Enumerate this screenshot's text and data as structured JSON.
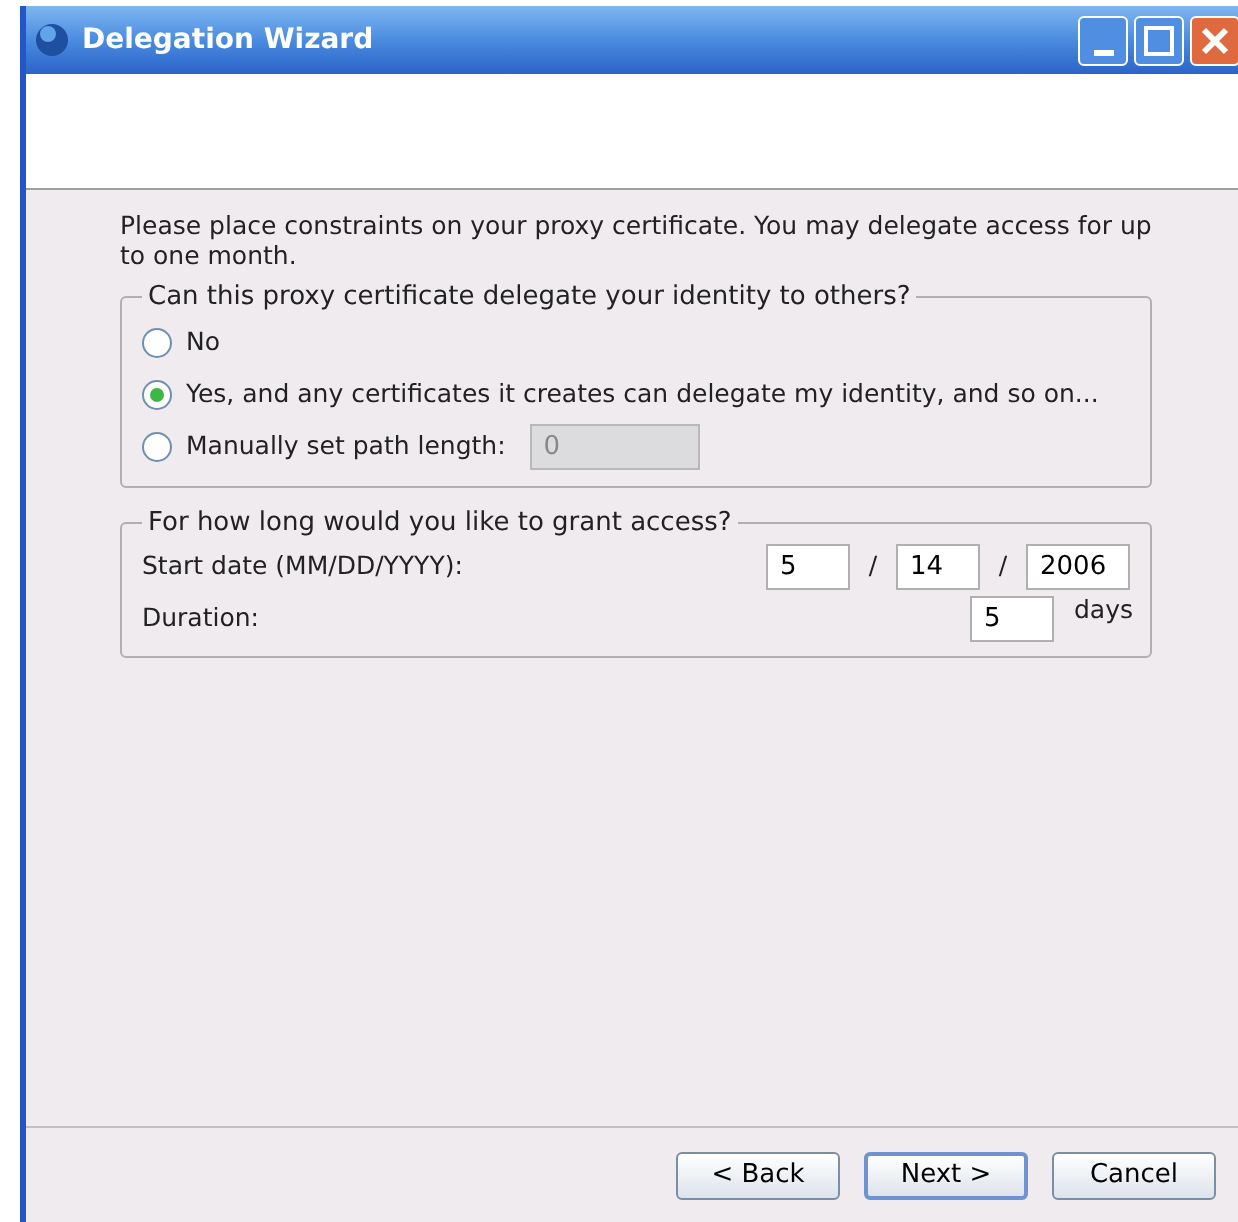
{
  "window": {
    "title": "Delegation Wizard"
  },
  "intro": "Please place constraints on your proxy certificate. You may delegate access for up to one month.",
  "delegation_group": {
    "title": "Can this proxy certificate delegate your identity to others?",
    "options": [
      {
        "label": "No",
        "selected": false
      },
      {
        "label": "Yes, and any certificates it creates can delegate my identity, and so on...",
        "selected": true
      },
      {
        "label": "Manually set path length:",
        "selected": false,
        "field": {
          "value": "0",
          "disabled": true
        }
      }
    ]
  },
  "access_group": {
    "title": "For how long would you like to grant access?",
    "start_date": {
      "label": "Start date (MM/DD/YYYY):",
      "month": "5",
      "separator_1": "/",
      "day": "14",
      "separator_2": "/",
      "year": "2006"
    },
    "duration": {
      "label": "Duration:",
      "value": "5",
      "unit": "days"
    }
  },
  "buttons": [
    {
      "label": "< Back",
      "default": false
    },
    {
      "label": "Next >",
      "default": true
    },
    {
      "label": "Cancel",
      "default": false
    }
  ]
}
